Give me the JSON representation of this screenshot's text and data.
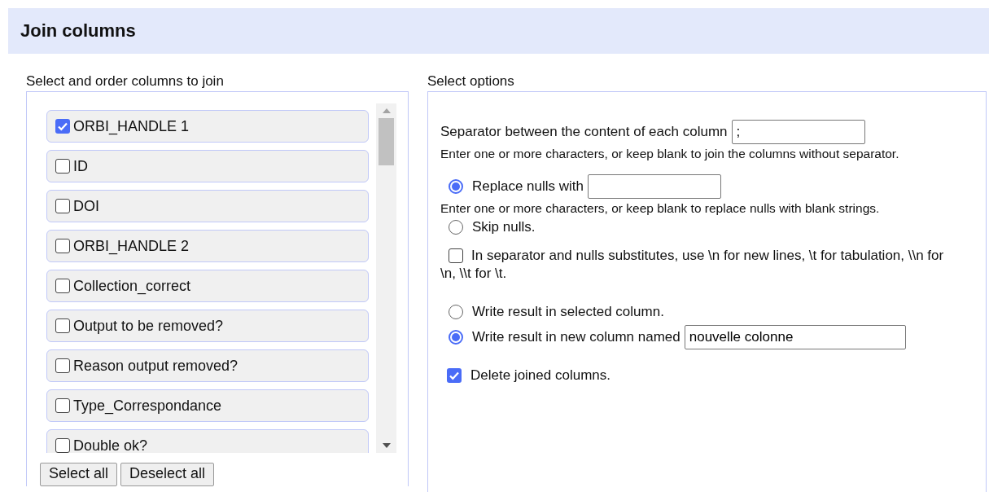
{
  "dialog": {
    "title": "Join columns"
  },
  "columns_panel": {
    "label": "Select and order columns to join",
    "items": [
      {
        "label": "ORBI_HANDLE 1",
        "checked": true
      },
      {
        "label": "ID",
        "checked": false
      },
      {
        "label": "DOI",
        "checked": false
      },
      {
        "label": "ORBI_HANDLE 2",
        "checked": false
      },
      {
        "label": "Collection_correct",
        "checked": false
      },
      {
        "label": "Output to be removed?",
        "checked": false
      },
      {
        "label": "Reason output removed?",
        "checked": false
      },
      {
        "label": "Type_Correspondance",
        "checked": false
      },
      {
        "label": "Double ok?",
        "checked": false
      }
    ],
    "buttons": [
      "Select all",
      "Deselect all"
    ]
  },
  "options_panel": {
    "label": "Select options",
    "separator": {
      "label": "Separator between the content of each column",
      "value": ";",
      "hint": "Enter one or more characters, or keep blank to join the columns without separator."
    },
    "nulls": [
      {
        "label": "Replace nulls with",
        "selected": true,
        "kind": "field",
        "hint": "Enter one or more characters, or keep blank to replace nulls with blank strings."
      },
      {
        "label": "Skip nulls.",
        "selected": false,
        "kind": "plain"
      }
    ],
    "escape": {
      "label": "In separator and nulls substitutes, use \\n for new lines, \\t for tabulation, \\\\n for \\n, \\\\t for \\t.",
      "checked": false
    },
    "result": [
      {
        "label": "Write result in selected column.",
        "selected": false
      },
      {
        "label": "Write result in new column named",
        "selected": true,
        "value": "nouvelle colonne"
      }
    ],
    "delete_joined": {
      "label": "Delete joined columns.",
      "checked": true
    }
  }
}
